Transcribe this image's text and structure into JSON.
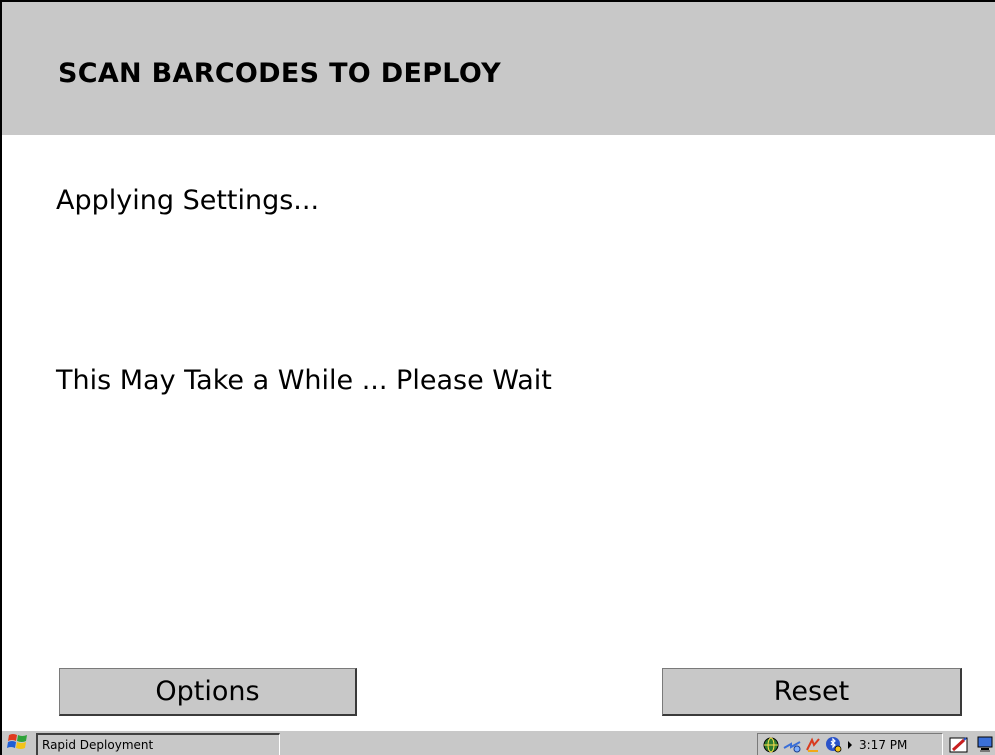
{
  "header": {
    "title": "SCAN BARCODES TO DEPLOY"
  },
  "status": {
    "primary": "Applying Settings...",
    "secondary": "This May Take a While ... Please Wait"
  },
  "buttons": {
    "options_label": "Options",
    "reset_label": "Reset"
  },
  "taskbar": {
    "task_label": "Rapid Deployment",
    "clock": "3:17 PM",
    "tray_icons": [
      "network-globe-icon",
      "connectivity-icon",
      "battery-power-icon",
      "bluetooth-icon"
    ],
    "edge_icons": [
      "input-panel-icon",
      "display-icon"
    ]
  },
  "colors": {
    "header_background": "#c8c8c8",
    "button_background": "#c8c8c8",
    "page_background": "#ffffff",
    "text": "#000000"
  }
}
